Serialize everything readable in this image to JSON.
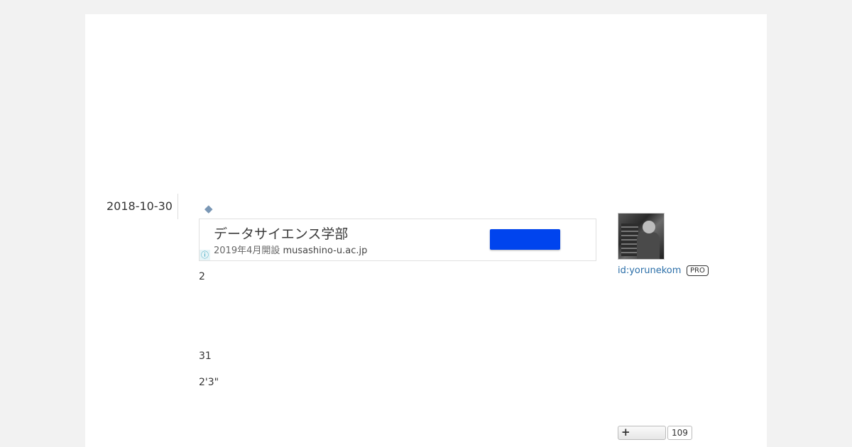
{
  "entry": {
    "date": "2018-10-30",
    "marker": "◆",
    "lines": [
      "2",
      "31",
      "2'3\""
    ]
  },
  "ad": {
    "title": "データサイエンス学部",
    "subtitle_prefix": "2019年4月開設",
    "domain": "musashino-u.ac.jp",
    "info_glyph": "ⓘ",
    "button_color": "#0044ee"
  },
  "sidebar": {
    "user_id": "id:yorunekom",
    "badge": "PRO"
  },
  "bookmark": {
    "plus_glyph": "+",
    "count": "109"
  },
  "colors": {
    "link": "#2a6ea8",
    "accent": "#7a97b5"
  }
}
